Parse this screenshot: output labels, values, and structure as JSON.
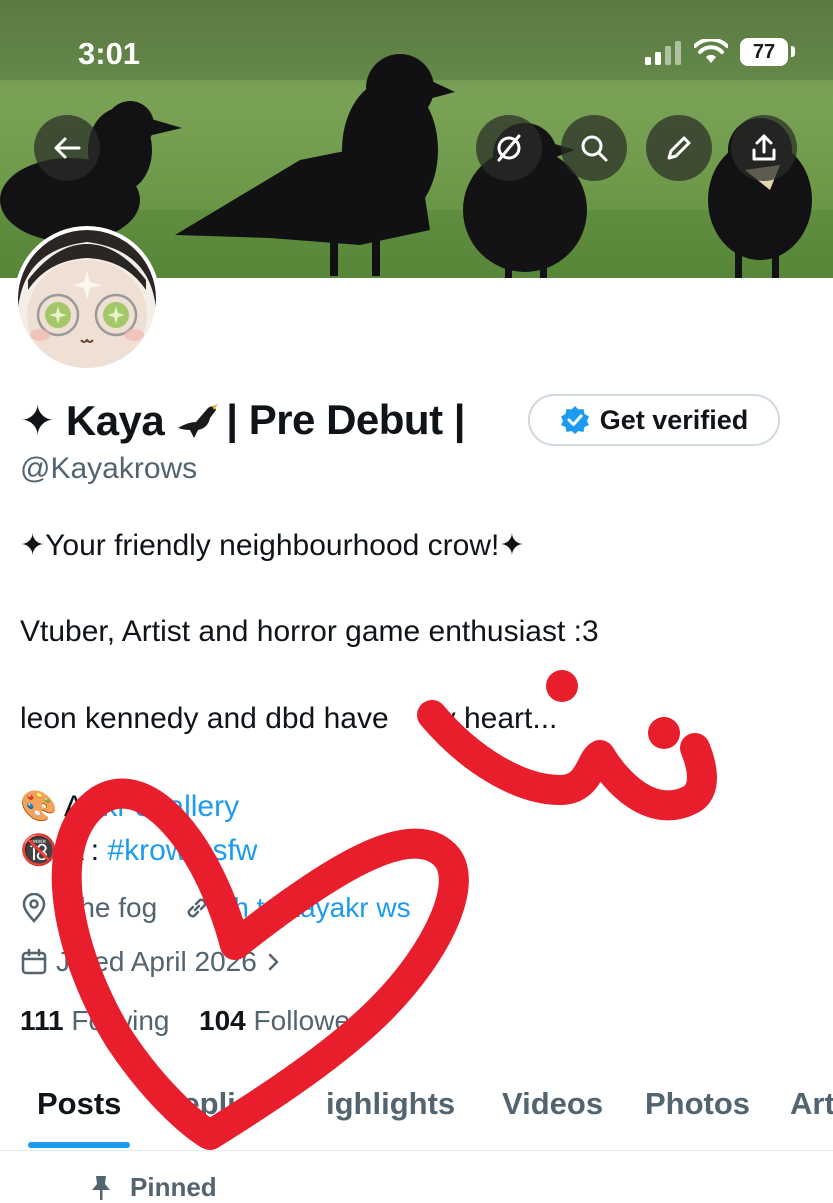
{
  "status_bar": {
    "time": "3:01",
    "battery": "77"
  },
  "profile": {
    "display_name": "✦ Kaya",
    "display_name_suffix": "| Pre Debut |",
    "get_verified_label": "Get verified",
    "handle": "@Kayakrows"
  },
  "bio": {
    "line1": "✦Your friendly neighbourhood crow!✦",
    "line2": "Vtuber, Artist and horror game enthusiast :3",
    "line3": "leon kennedy and dbd have",
    "line3_tail": "y heart...",
    "art_label": "Ar",
    "art_link": "kr     sgallery",
    "nsfw_label": "A  :",
    "nsfw_link": "#krow  nsfw"
  },
  "meta": {
    "location": "I   the fog",
    "website": "ch.tv/kayakr  ws",
    "joined": "J   ned April 2026"
  },
  "counts": {
    "following_count": "111",
    "following_label": "Fo    wing",
    "followers_count": "104",
    "followers_label": "Followers"
  },
  "tabs": [
    {
      "label": "Posts"
    },
    {
      "label": "Replies"
    },
    {
      "label": "ighlights"
    },
    {
      "label": "Videos"
    },
    {
      "label": "Photos"
    },
    {
      "label": "Art"
    }
  ],
  "pinned_label": "Pinned",
  "colors": {
    "accent_blue": "#1d9bf0",
    "secondary_text": "#536471",
    "doodle_red": "#e81e2c"
  },
  "icons": {
    "back": "arrow-left-icon",
    "grok": "grok-icon",
    "search": "search-icon",
    "edit": "pencil-icon",
    "share": "share-icon",
    "location": "location-pin-icon",
    "link": "link-icon",
    "calendar": "calendar-icon",
    "pin": "pin-icon"
  }
}
